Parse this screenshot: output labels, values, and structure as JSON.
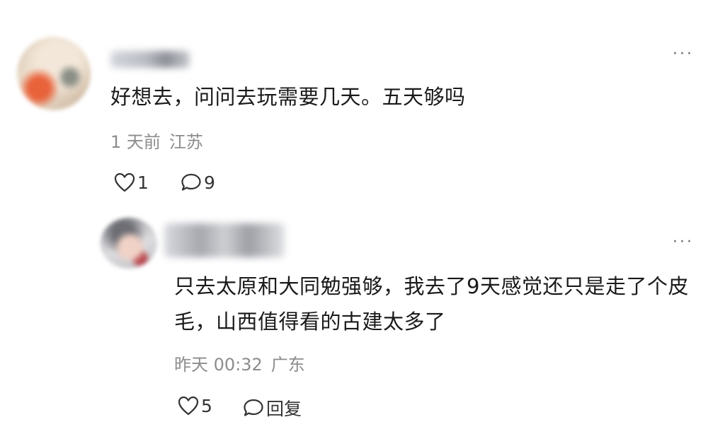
{
  "comment": {
    "more_label": "···",
    "content": "好想去，问问去玩需要几天。五天够吗",
    "time": "1 天前",
    "location": "江苏",
    "like_count": "1",
    "reply_count": "9"
  },
  "reply": {
    "more_label": "···",
    "content": "只去太原和大同勉强够，我去了9天感觉还只是走了个皮毛，山西值得看的古建太多了",
    "time": "昨天 00:32",
    "location": "广东",
    "like_count": "5",
    "reply_label": "回复"
  },
  "icons": {
    "like": "heart-outline-icon",
    "reply": "speech-bubble-outline-icon",
    "more": "ellipsis-icon"
  }
}
